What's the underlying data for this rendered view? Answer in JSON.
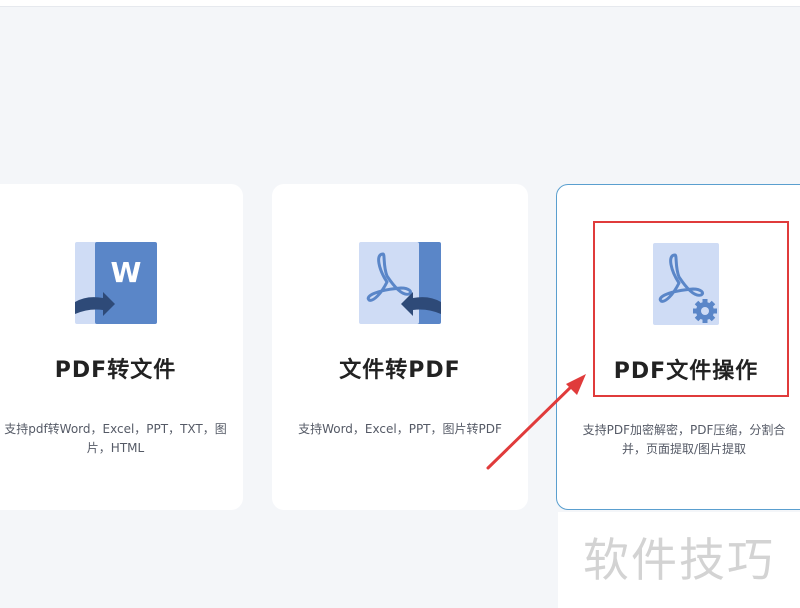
{
  "cards": [
    {
      "title": "PDF转文件",
      "description": "支持pdf转Word，Excel，PPT，TXT，图片，HTML",
      "icon": "pdf-to-word-icon"
    },
    {
      "title": "文件转PDF",
      "description": "支持Word，Excel，PPT，图片转PDF",
      "icon": "file-to-pdf-icon"
    },
    {
      "title": "PDF文件操作",
      "description": "支持PDF加密解密，PDF压缩，分割合并，页面提取/图片提取",
      "icon": "pdf-settings-icon"
    }
  ],
  "colors": {
    "icon_dark": "#5a86c8",
    "icon_light": "#cfdcf5",
    "highlight": "#e03b3b",
    "card_border_active": "#5a9fcf"
  },
  "watermark": "软件技巧"
}
